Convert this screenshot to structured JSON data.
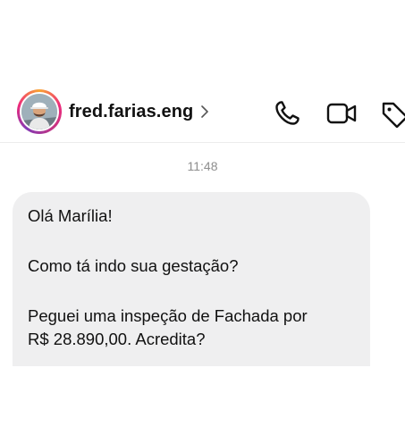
{
  "header": {
    "username": "fred.farias.eng",
    "icons": {
      "avatar": "profile-avatar",
      "chevron": "chevron-right-icon",
      "call": "phone-icon",
      "video": "video-camera-icon",
      "tag": "tag-icon"
    }
  },
  "conversation": {
    "timestamp": "11:48",
    "message": {
      "line1": "Olá Marília!",
      "line2": "Como tá indo sua gestação?",
      "line3": "Peguei uma inspeção de Fachada por",
      "line4": "R$ 28.890,00. Acredita?"
    }
  },
  "colors": {
    "bubble": "#efeff0",
    "timestamp": "#8e8e8e",
    "text": "#111111",
    "ring_start": "#f9a533",
    "ring_end": "#c13584"
  }
}
